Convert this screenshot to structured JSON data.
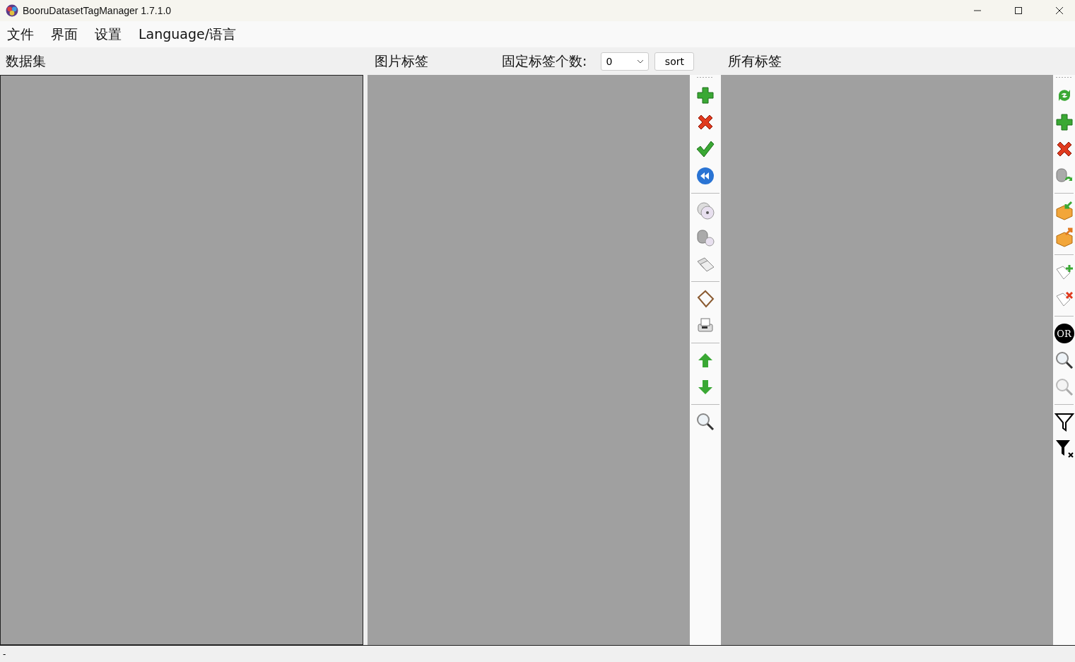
{
  "window": {
    "title": "BooruDatasetTagManager 1.7.1.0"
  },
  "menu": [
    {
      "label": "文件"
    },
    {
      "label": "界面"
    },
    {
      "label": "设置"
    },
    {
      "label": "Language/语言"
    }
  ],
  "dataset_panel": {
    "title": "数据集"
  },
  "image_tags_panel": {
    "title": "图片标签",
    "fixed_count_label": "固定标签个数:",
    "fixed_count_value": "0",
    "sort_button": "sort"
  },
  "all_tags_panel": {
    "title": "所有标签",
    "or_button": "OR"
  },
  "status_bar": {
    "text": "-"
  }
}
